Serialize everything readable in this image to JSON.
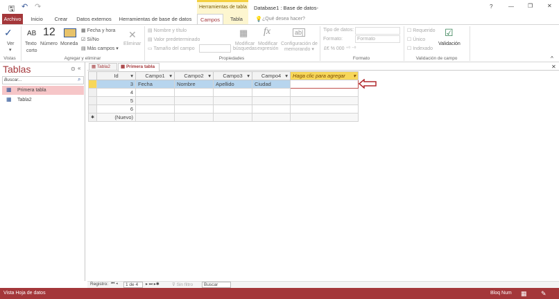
{
  "title_bar": {
    "context_label": "Herramientas de tabla",
    "title": "Database1 : Base de datos-",
    "help": "?",
    "minimize": "—",
    "restore": "❐",
    "close": "✕"
  },
  "qat": {
    "save_icon": "save-icon",
    "undo": "↶",
    "redo": "↷"
  },
  "tabs": [
    {
      "label": "Archivo"
    },
    {
      "label": "Inicio"
    },
    {
      "label": "Crear"
    },
    {
      "label": "Datos externos"
    },
    {
      "label": "Herramientas de base de datos"
    },
    {
      "label": "Campos"
    },
    {
      "label": "Tabla"
    }
  ],
  "tell_me": "¿Qué desea hacer?",
  "ribbon": {
    "vistas": {
      "ver": "Ver",
      "group": "Vistas"
    },
    "agregar": {
      "texto": "Texto",
      "corto": "corto",
      "ab": "AB",
      "numero_icon": "12",
      "numero": "Número",
      "moneda": "Moneda",
      "fecha": "Fecha y hora",
      "sino": "Sí/No",
      "mas": "Más campos",
      "eliminar": "Eliminar",
      "group": "Agregar y eliminar"
    },
    "propiedades": {
      "nombre": "Nombre y título",
      "valor": "Valor predeterminado",
      "tamano": "Tamaño del campo",
      "mod_busq1": "Modificar",
      "mod_busq2": "búsquedas",
      "mod_exp1": "Modificar",
      "mod_exp2": "expresión",
      "config1": "Configuración de",
      "config2": "memorando",
      "group": "Propiedades"
    },
    "formato": {
      "tipo": "Tipo de datos:",
      "formato_lbl": "Formato:",
      "formato_val": "Formato",
      "group": "Formato"
    },
    "validacion": {
      "requerido": "Requerido",
      "unico": "Único",
      "indexado": "Indexado",
      "validacion": "Validación",
      "group": "Validación de campo"
    }
  },
  "nav": {
    "title": "Tablas",
    "search_placeholder": "Buscar...",
    "items": [
      {
        "label": "Primera tabla",
        "selected": true
      },
      {
        "label": "Tabla2",
        "selected": false
      }
    ]
  },
  "doc_tabs": [
    {
      "label": "Tabla2"
    },
    {
      "label": "Primera tabla",
      "active": true
    }
  ],
  "table": {
    "columns": [
      "Id",
      "Campo1",
      "Campo2",
      "Campo3",
      "Campo4",
      "Haga clic para agregar"
    ],
    "rows": [
      [
        "3",
        "Fecha",
        "Nombre",
        "Apellido",
        "Ciudad",
        ""
      ],
      [
        "4",
        "",
        "",
        "",
        "",
        ""
      ],
      [
        "5",
        "",
        "",
        "",
        "",
        ""
      ],
      [
        "6",
        "",
        "",
        "",
        "",
        ""
      ],
      [
        "(Nuevo)",
        "",
        "",
        "",
        "",
        ""
      ]
    ]
  },
  "record_nav": {
    "label": "Registro:",
    "position": "1 de 4",
    "filter": "Sin filtro",
    "search": "Buscar"
  },
  "status": {
    "left": "Vista Hoja de datos",
    "right": "Bloq Num"
  },
  "colors": {
    "accent": "#a4373a",
    "selected_row": "#b7d5ee",
    "new_col_header": "#f7d75a",
    "nav_selected": "#f6c6c8"
  }
}
